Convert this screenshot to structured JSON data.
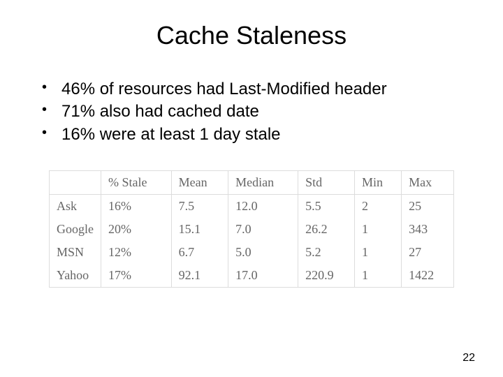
{
  "title": "Cache Staleness",
  "bullets": [
    "46% of resources had Last-Modified header",
    "71% also had cached date",
    "16% were at least 1 day stale"
  ],
  "chart_data": {
    "type": "table",
    "columns": [
      "",
      "% Stale",
      "Mean",
      "Median",
      "Std",
      "Min",
      "Max"
    ],
    "rows": [
      {
        "label": "Ask",
        "pct_stale": "16%",
        "mean": "7.5",
        "median": "12.0",
        "std": "5.5",
        "min": "2",
        "max": "25"
      },
      {
        "label": "Google",
        "pct_stale": "20%",
        "mean": "15.1",
        "median": "7.0",
        "std": "26.2",
        "min": "1",
        "max": "343"
      },
      {
        "label": "MSN",
        "pct_stale": "12%",
        "mean": "6.7",
        "median": "5.0",
        "std": "5.2",
        "min": "1",
        "max": "27"
      },
      {
        "label": "Yahoo",
        "pct_stale": "17%",
        "mean": "92.1",
        "median": "17.0",
        "std": "220.9",
        "min": "1",
        "max": "1422"
      }
    ]
  },
  "page_number": "22"
}
